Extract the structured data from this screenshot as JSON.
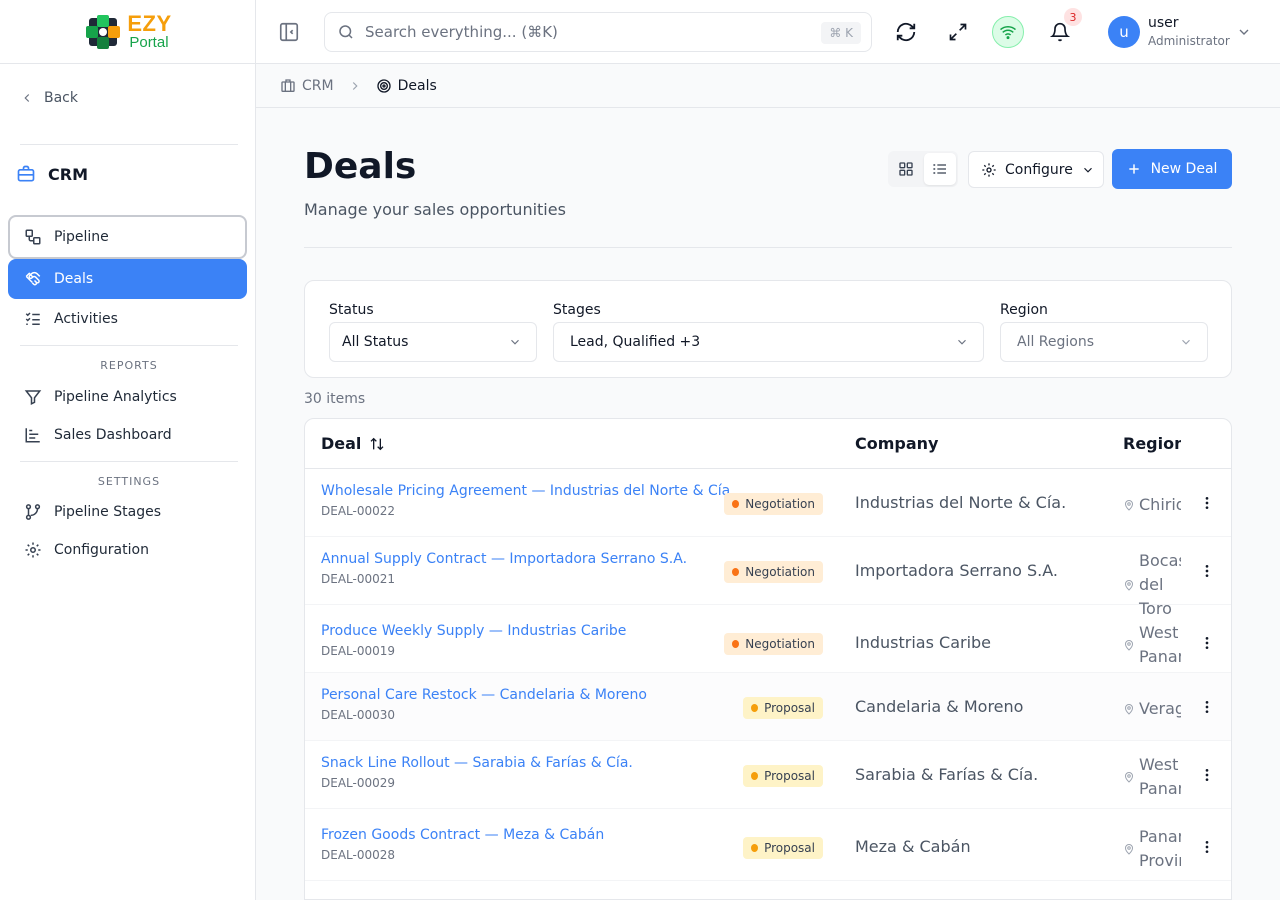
{
  "brand": {
    "line1": "EZY",
    "line2": "Portal"
  },
  "sidebar": {
    "back_label": "Back",
    "section_title": "CRM",
    "items": [
      {
        "label": "Pipeline",
        "icon": "pipeline-icon"
      },
      {
        "label": "Deals",
        "icon": "handshake-icon"
      },
      {
        "label": "Activities",
        "icon": "checklist-icon"
      }
    ],
    "reports_heading": "REPORTS",
    "reports": [
      {
        "label": "Pipeline Analytics",
        "icon": "funnel-icon"
      },
      {
        "label": "Sales Dashboard",
        "icon": "bar-chart-icon"
      }
    ],
    "settings_heading": "SETTINGS",
    "settings": [
      {
        "label": "Pipeline Stages",
        "icon": "git-branch-icon"
      },
      {
        "label": "Configuration",
        "icon": "gear-icon"
      }
    ]
  },
  "topbar": {
    "search_placeholder": "Search everything... (⌘K)",
    "search_shortcut": "⌘ K",
    "notification_count": "3",
    "user_initial": "u",
    "user_name": "user",
    "user_role": "Administrator"
  },
  "breadcrumb": {
    "parent": "CRM",
    "current": "Deals"
  },
  "page": {
    "title": "Deals",
    "subtitle": "Manage your sales opportunities",
    "configure_label": "Configure",
    "new_deal_label": "New Deal"
  },
  "filters": {
    "status": {
      "label": "Status",
      "value": "All Status"
    },
    "stages": {
      "label": "Stages",
      "value": "Lead, Qualified +3"
    },
    "region": {
      "label": "Region",
      "value": "All Regions"
    }
  },
  "items_count": "30 items",
  "table": {
    "columns": {
      "deal": "Deal",
      "company": "Company",
      "region": "Region"
    },
    "rows": [
      {
        "name": "Wholesale Pricing Agreement — Industrias del Norte & Cía.",
        "id": "DEAL-00022",
        "stage": "Negotiation",
        "company": "Industrias del Norte & Cía.",
        "region": "Chiriquí"
      },
      {
        "name": "Annual Supply Contract — Importadora Serrano S.A.",
        "id": "DEAL-00021",
        "stage": "Negotiation",
        "company": "Importadora Serrano S.A.",
        "region": "Bocas del Toro"
      },
      {
        "name": "Produce Weekly Supply — Industrias Caribe",
        "id": "DEAL-00019",
        "stage": "Negotiation",
        "company": "Industrias Caribe",
        "region": "West Panamá"
      },
      {
        "name": "Personal Care Restock — Candelaria & Moreno",
        "id": "DEAL-00030",
        "stage": "Proposal",
        "company": "Candelaria & Moreno",
        "region": "Veraguas"
      },
      {
        "name": "Snack Line Rollout — Sarabia & Farías & Cía.",
        "id": "DEAL-00029",
        "stage": "Proposal",
        "company": "Sarabia & Farías & Cía.",
        "region": "West Panamá"
      },
      {
        "name": "Frozen Goods Contract — Meza & Cabán",
        "id": "DEAL-00028",
        "stage": "Proposal",
        "company": "Meza & Cabán",
        "region": "Panamá Province"
      }
    ]
  },
  "colors": {
    "accent": "#3b82f6",
    "negotiation_dot": "#f97316",
    "negotiation_bg": "#ffedd5",
    "proposal_dot": "#f59e0b",
    "proposal_bg": "#fef3c7"
  }
}
